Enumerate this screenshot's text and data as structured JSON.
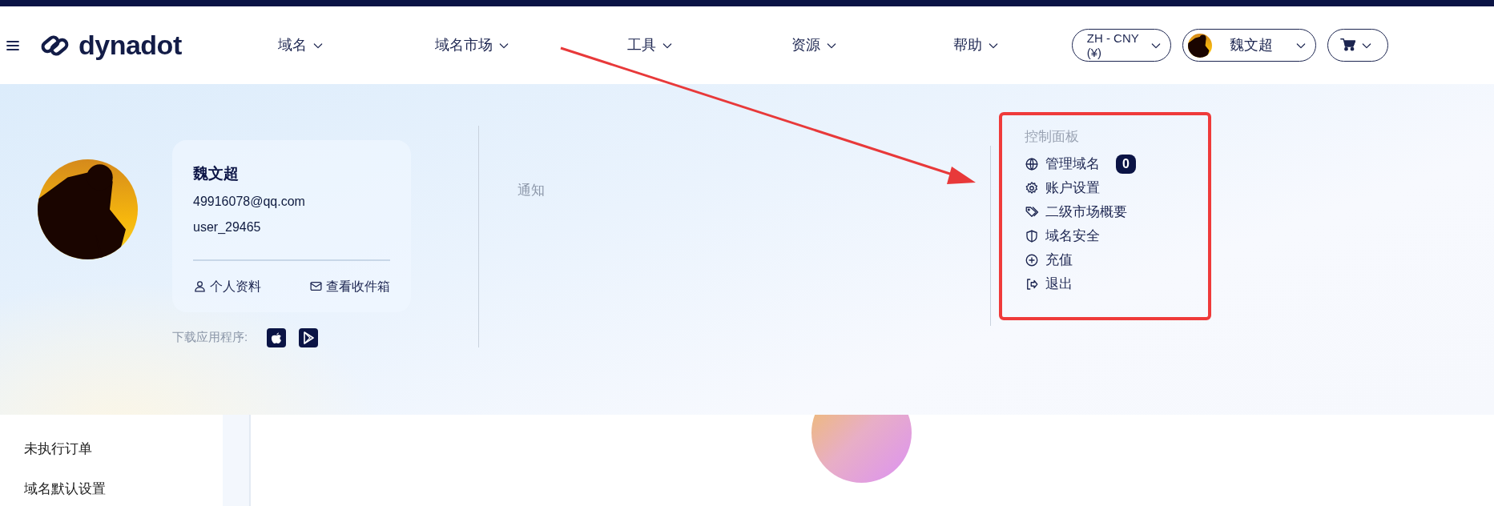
{
  "header": {
    "logo": "dynadot",
    "menu": [
      {
        "label": "域名"
      },
      {
        "label": "域名市场"
      },
      {
        "label": "工具"
      },
      {
        "label": "资源"
      },
      {
        "label": "帮助"
      }
    ],
    "language": "ZH - CNY (¥)",
    "user": "魏文超"
  },
  "profile": {
    "name": "魏文超",
    "email": "49916078@qq.com",
    "username": "user_29465",
    "links": [
      {
        "label": "个人资料",
        "kind": "user"
      },
      {
        "label": "查看收件箱",
        "kind": "mail"
      }
    ],
    "download_label": "下载应用程序:"
  },
  "notifications": {
    "title": "通知"
  },
  "dashboard": {
    "title": "控制面板",
    "items": [
      {
        "label": "管理域名",
        "kind": "globe",
        "badge": "0"
      },
      {
        "label": "账户设置",
        "kind": "gear"
      },
      {
        "label": "二级市场概要",
        "kind": "tag"
      },
      {
        "label": "域名安全",
        "kind": "shield"
      },
      {
        "label": "充值",
        "kind": "plus"
      },
      {
        "label": "退出",
        "kind": "logout"
      }
    ]
  },
  "sidebar": {
    "items": [
      "未执行订单",
      "域名默认设置"
    ]
  }
}
